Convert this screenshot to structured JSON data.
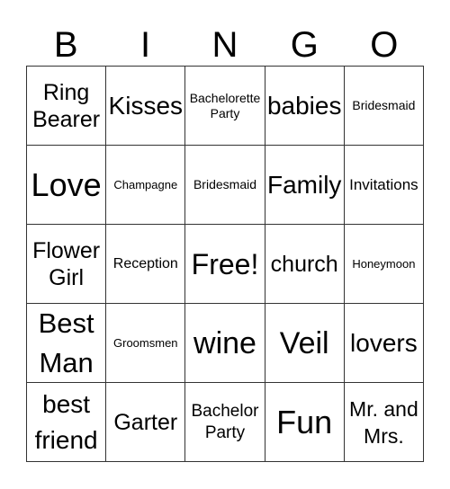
{
  "header": {
    "letters": [
      "B",
      "I",
      "N",
      "G",
      "O"
    ]
  },
  "cells": [
    [
      "Ring Bearer",
      "Kisses",
      "Bachelorette Party",
      "babies",
      "Bridesmaid"
    ],
    [
      "Love",
      "Champagne",
      "Bridesmaid",
      "Family",
      "Invitations"
    ],
    [
      "Flower Girl",
      "Reception",
      "Free!",
      "church",
      "Honeymoon"
    ],
    [
      "Best Man",
      "Groomsmen",
      "wine",
      "Veil",
      "lovers"
    ],
    [
      "best friend",
      "Garter",
      "Bachelor Party",
      "Fun",
      "Mr. and Mrs."
    ]
  ]
}
